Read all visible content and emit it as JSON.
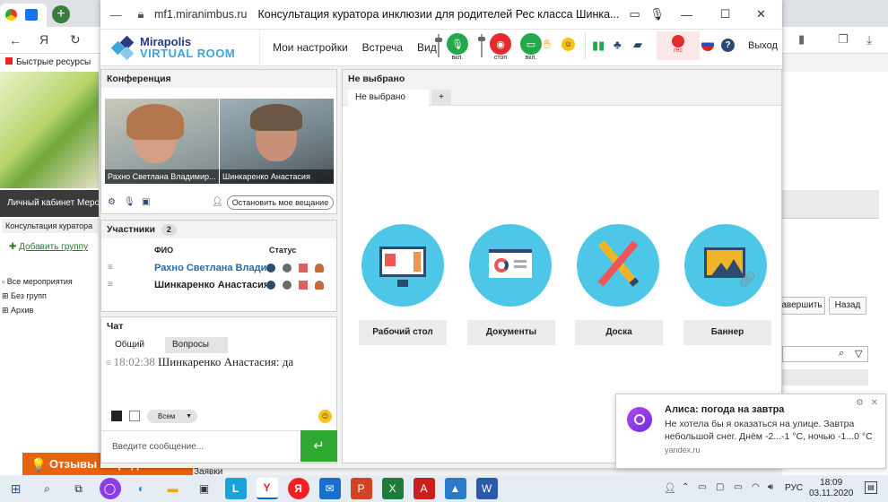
{
  "browser": {
    "bookmarks": "Быстрые ресурсы",
    "left_nav": "Личный кабинет   Меро",
    "crumb": "Консультация куратора",
    "add_group": "Добавить группу",
    "tree": [
      "Все мероприятия",
      "Без групп",
      "Архив"
    ],
    "feedback": "Отзывы и предложения",
    "under_label": "Заявки",
    "right_buttons": [
      "авершить",
      "Назад"
    ]
  },
  "window": {
    "url": "mf1.miranimbus.ru",
    "title": "Консультация куратора инклюзии для родителей Рес класса Шинка..."
  },
  "app": {
    "logo_line1": "Mirapolis",
    "logo_line2": "VIRTUAL ROOM",
    "menu": [
      "Мои настройки",
      "Встреча",
      "Вид"
    ],
    "mic_label": "вкл.",
    "stop_label": "стоп",
    "screen_label": "вкл.",
    "rec_label": "rec",
    "exit": "Выход",
    "help": "?"
  },
  "conference": {
    "title": "Конференция",
    "videos": [
      "Рахно Светлана Владимир...",
      "Шинкаренко Анастасия"
    ],
    "stop_broadcast": "Остановить мое вещание"
  },
  "participants": {
    "title": "Участники",
    "count": "2",
    "col_name": "ФИО",
    "col_status": "Статус",
    "rows": [
      "Рахно Светлана Владимиро...",
      "Шинкаренко Анастасия"
    ]
  },
  "chat": {
    "title": "Чат",
    "tabs": [
      "Общий",
      "Вопросы"
    ],
    "messages": [
      {
        "time": "18:02:38",
        "author": "Шинкаренко Анастасия:",
        "text": "да"
      }
    ],
    "recipient": "Всем",
    "placeholder": "Введите сообщение..."
  },
  "content": {
    "title": "Не выбрано",
    "tab": "Не выбрано",
    "add_tab": "+",
    "actions": [
      "Рабочий стол",
      "Документы",
      "Доска",
      "Баннер"
    ]
  },
  "notification": {
    "title": "Алиса: погода на завтра",
    "body": "Не хотела бы я оказаться на улице. Завтра небольшой снег. Днём -2...-1 °C, ночью -1...0 °C",
    "source": "yandex.ru"
  },
  "taskbar": {
    "lang": "РУС",
    "time": "18:09",
    "date": "03.11.2020"
  },
  "colors": {
    "accent_green": "#23a94b",
    "rec_red": "#e22b2b",
    "tile_blue": "#4dc6e8",
    "send_green": "#2fa832"
  }
}
